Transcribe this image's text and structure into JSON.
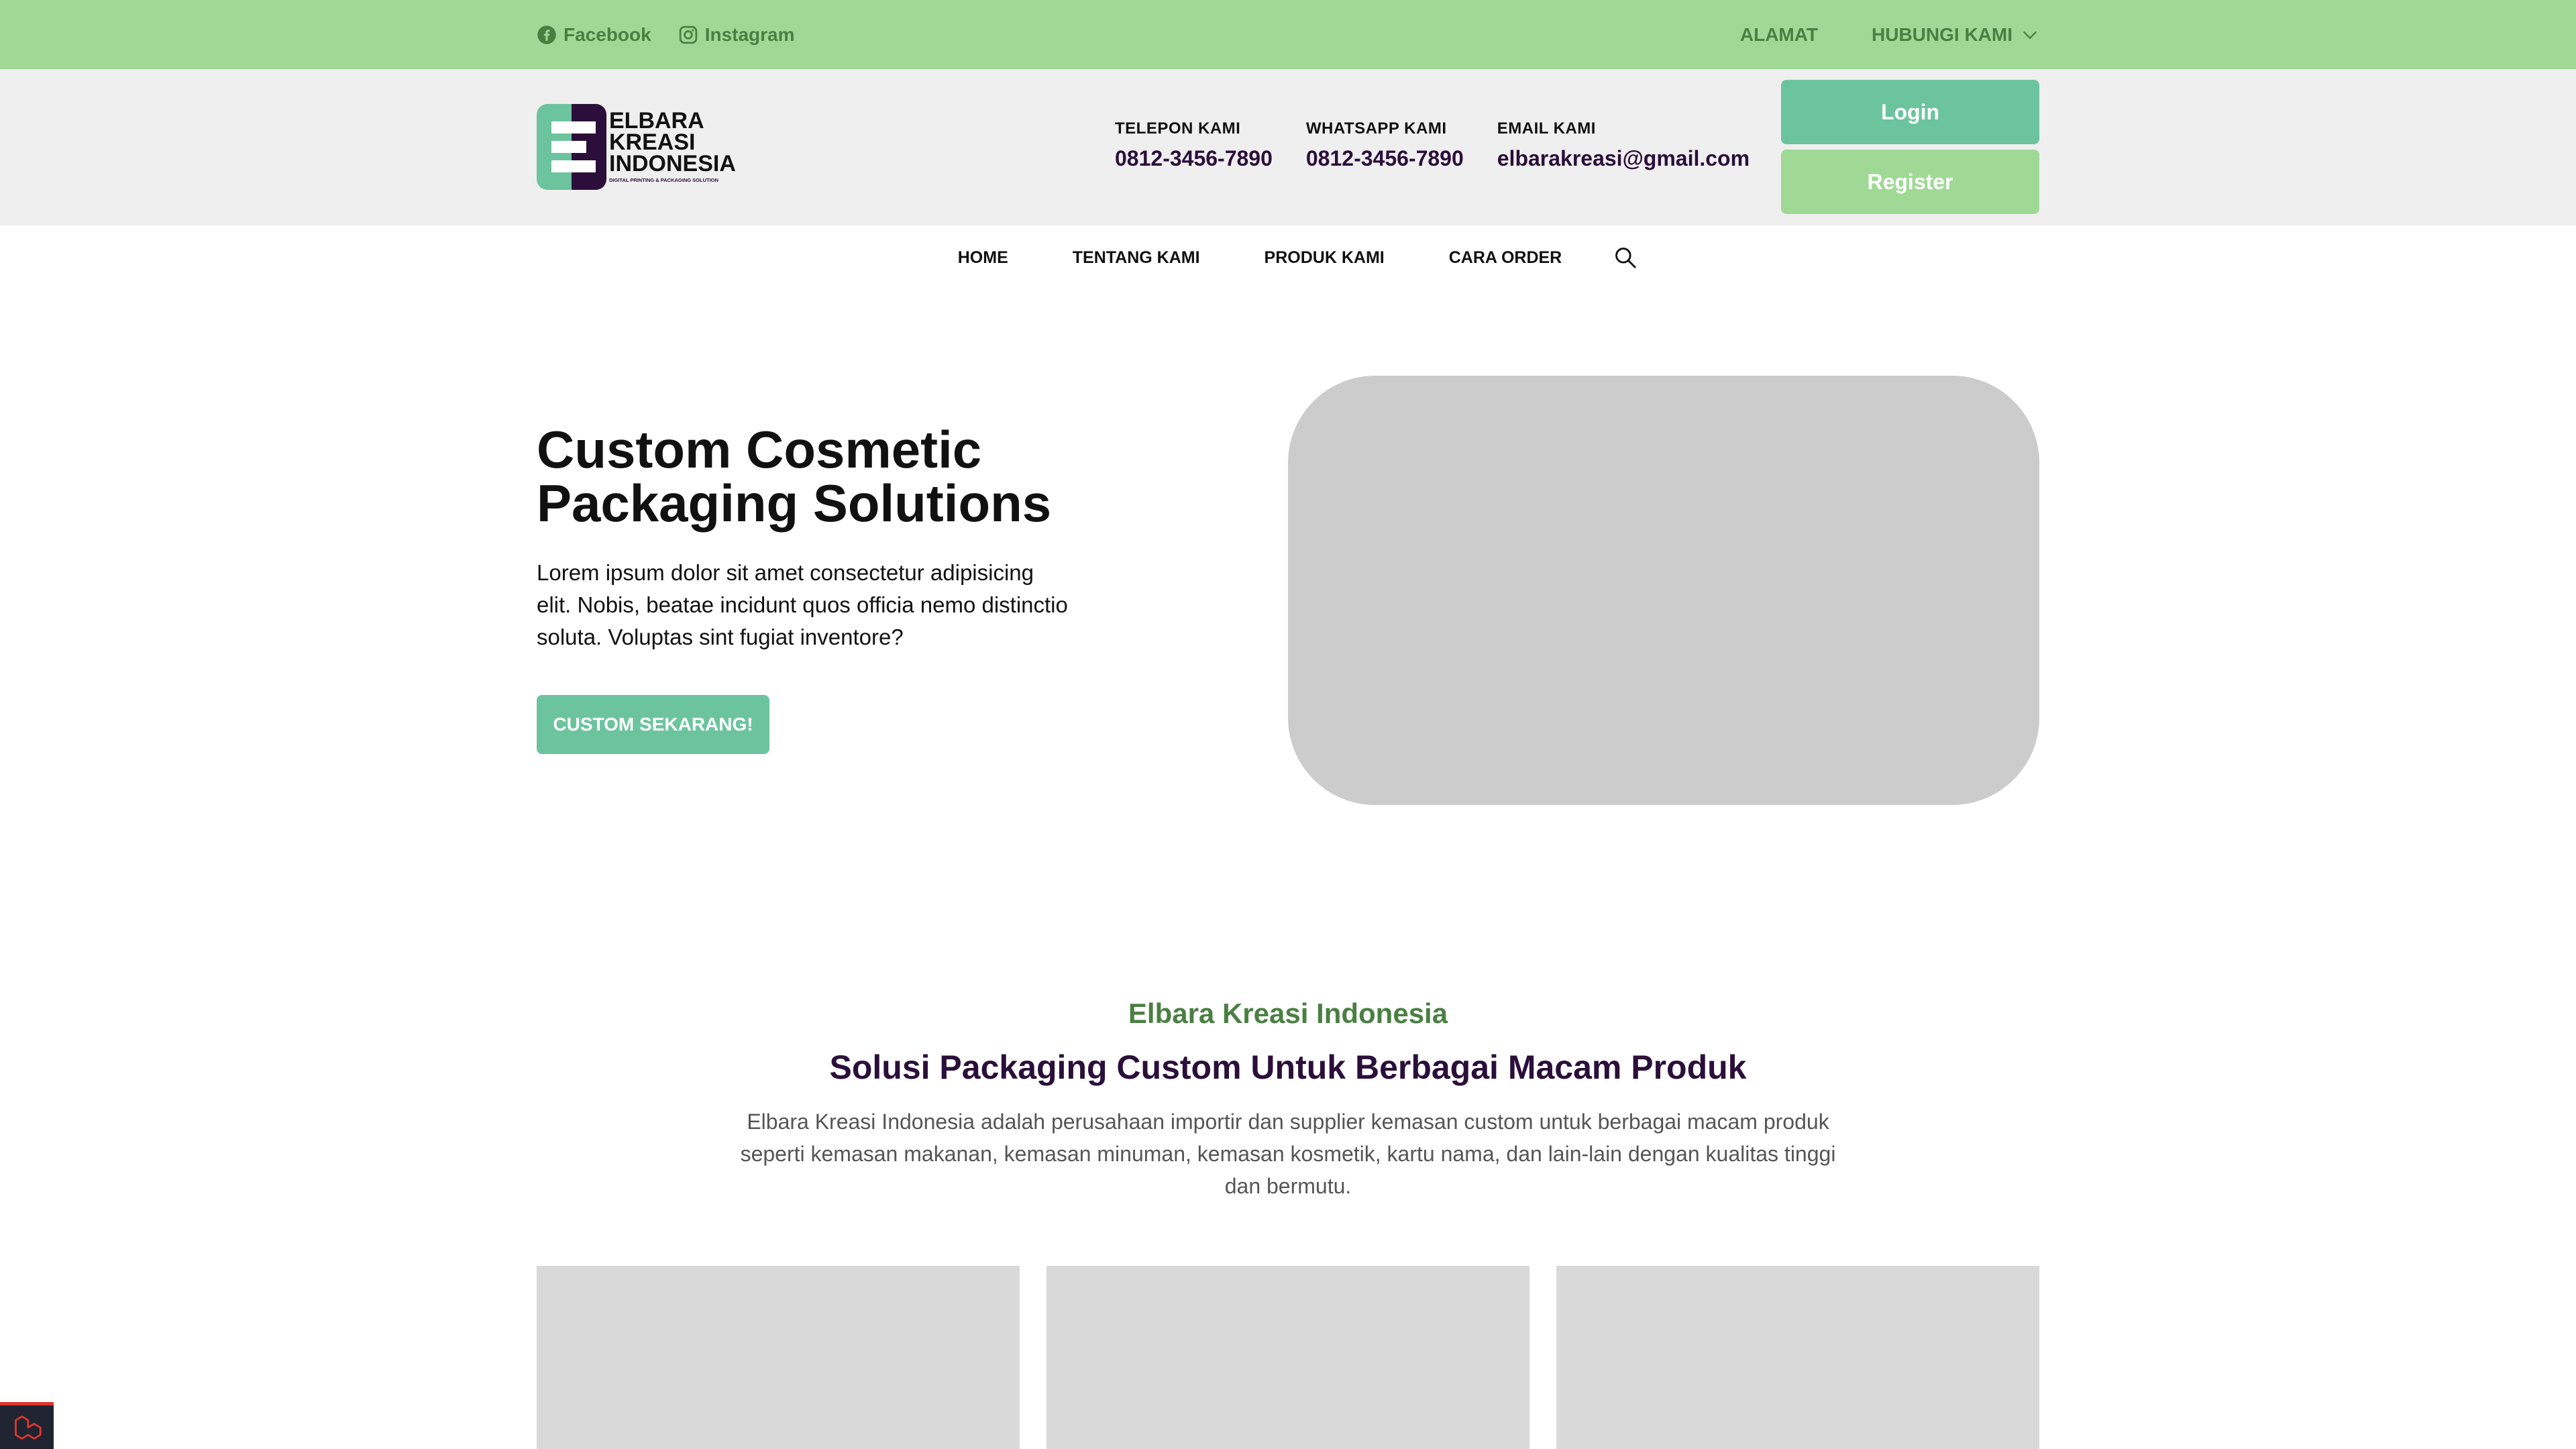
{
  "topbar": {
    "social": [
      {
        "label": "Facebook",
        "icon": "facebook-icon"
      },
      {
        "label": "Instagram",
        "icon": "instagram-icon"
      }
    ],
    "links": {
      "alamat": "ALAMAT",
      "hubungi": "HUBUNGI KAMI"
    }
  },
  "header": {
    "logo": {
      "line1": "ELBARA",
      "line2": "KREASI",
      "line3": "INDONESIA",
      "tagline": "DIGITAL PRINTING & PACKAGING SOLUTION"
    },
    "contacts": [
      {
        "label": "TELEPON KAMI",
        "value": "0812-3456-7890"
      },
      {
        "label": "WHATSAPP KAMI",
        "value": "0812-3456-7890"
      },
      {
        "label": "EMAIL KAMI",
        "value": "elbarakreasi@gmail.com"
      }
    ],
    "login_label": "Login",
    "register_label": "Register"
  },
  "nav": {
    "items": [
      "HOME",
      "TENTANG KAMI",
      "PRODUK KAMI",
      "CARA ORDER"
    ]
  },
  "hero": {
    "title": "Custom Cosmetic Packaging Solutions",
    "description": "Lorem ipsum dolor sit amet consectetur adipisicing elit. Nobis, beatae incidunt quos officia nemo distinctio soluta. Voluptas sint fugiat inventore?",
    "cta": "CUSTOM SEKARANG!"
  },
  "about": {
    "kicker": "Elbara Kreasi Indonesia",
    "title": "Solusi Packaging Custom Untuk Berbagai Macam Produk",
    "description": "Elbara Kreasi Indonesia adalah perusahaan importir dan supplier kemasan custom untuk berbagai macam produk seperti kemasan makanan, kemasan minuman, kemasan kosmetik, kartu nama, dan lain-lain dengan kualitas tinggi dan bermutu."
  },
  "colors": {
    "topbar": "#9fd995",
    "accent": "#6cc49e",
    "green_text": "#4a7f42",
    "purple": "#2b0f3a",
    "header_bg": "#efefef"
  }
}
